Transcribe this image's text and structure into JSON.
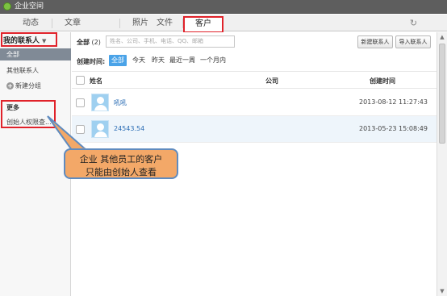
{
  "window": {
    "title": "企业空间"
  },
  "tabs": [
    {
      "label": "动态"
    },
    {
      "label": "文章"
    },
    {
      "label": "照片"
    },
    {
      "label": "文件"
    },
    {
      "label": "客户"
    }
  ],
  "active_tab": "客户",
  "sidebar": {
    "header": "我的联系人",
    "items": [
      {
        "label": "全部"
      },
      {
        "label": "其他联系人"
      }
    ],
    "new_group": "新建分组",
    "more_header": "更多",
    "more_item": "创始人权限查..."
  },
  "toolbar": {
    "all_label": "全部",
    "count": "(2)",
    "search_placeholder": "姓名、公司、手机、电话、QQ、邮箱",
    "new_contact": "新建联系人",
    "import_contact": "导入联系人"
  },
  "filters": {
    "label": "创建时间:",
    "options": [
      "全部",
      "今天",
      "昨天",
      "最近一周",
      "一个月内"
    ],
    "active": "全部"
  },
  "table": {
    "columns": [
      "姓名",
      "公司",
      "创建时间"
    ],
    "rows": [
      {
        "name": "吼吼",
        "company": "",
        "created": "2013-08-12 11:27:43"
      },
      {
        "name": "24543.54",
        "company": "",
        "created": "2013-05-23 15:08:49"
      }
    ]
  },
  "callout": {
    "line1": "企业  其他员工的客户",
    "line2": "只能由创始人查看"
  },
  "colors": {
    "highlight": "#e0222a",
    "callout_fill": "#f3a868",
    "callout_border": "#5f8bbf",
    "active_filter": "#4aa3e8",
    "link": "#2a6cb4"
  }
}
